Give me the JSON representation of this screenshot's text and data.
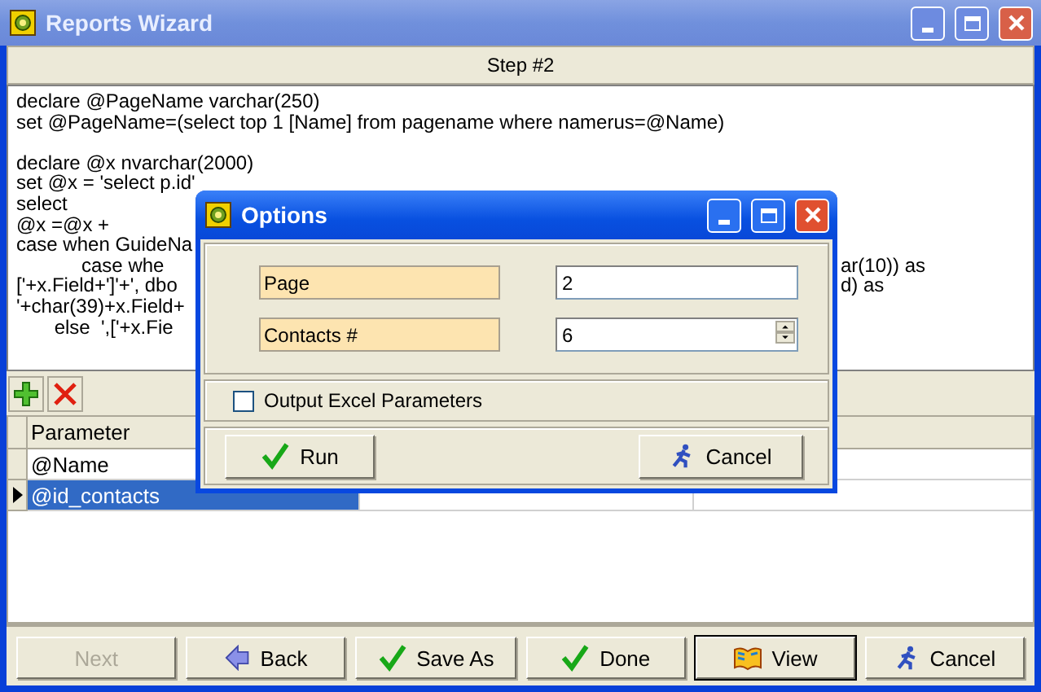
{
  "window": {
    "title": "Reports Wizard"
  },
  "step_header": "Step #2",
  "code_lines": [
    {
      "kind": "text",
      "left": "declare @PageName varchar(250)"
    },
    {
      "kind": "text",
      "left": "set @PageName=(select top 1 [Name] from pagename where namerus=@Name)"
    },
    {
      "kind": "blank"
    },
    {
      "kind": "text",
      "left": "declare @x nvarchar(2000)"
    },
    {
      "kind": "text",
      "left": "set @x = 'select p.id'"
    },
    {
      "kind": "text",
      "left": "select"
    },
    {
      "kind": "text",
      "left": "@x =@x +"
    },
    {
      "kind": "text",
      "left": "case when GuideNa"
    },
    {
      "kind": "text",
      "left": "            case whe",
      "right": "ar(10)) as"
    },
    {
      "kind": "text",
      "left": "['+x.Field+']'+', dbo",
      "right": "d) as"
    },
    {
      "kind": "text",
      "left": "'+char(39)+x.Field+"
    },
    {
      "kind": "text",
      "left": "       else  ',['+x.Fie"
    }
  ],
  "grid": {
    "columns": [
      "Parameter"
    ],
    "rows": [
      {
        "cells": [
          "@Name"
        ],
        "selected": false
      },
      {
        "cells": [
          "@id_contacts"
        ],
        "selected": true
      }
    ]
  },
  "buttons": [
    {
      "label": "Next",
      "kind": "none",
      "disabled": true,
      "default": false
    },
    {
      "label": "Back",
      "kind": "back",
      "disabled": false,
      "default": false
    },
    {
      "label": "Save As",
      "kind": "check",
      "disabled": false,
      "default": false
    },
    {
      "label": "Done",
      "kind": "check",
      "disabled": false,
      "default": false
    },
    {
      "label": "View",
      "kind": "book",
      "disabled": false,
      "default": true
    },
    {
      "label": "Cancel",
      "kind": "runner",
      "disabled": false,
      "default": false
    }
  ],
  "dialog": {
    "title": "Options",
    "fields": [
      {
        "label": "Page",
        "value": "2",
        "kind": "text"
      },
      {
        "label": "Contacts #",
        "value": "6",
        "kind": "spin"
      }
    ],
    "checkbox": {
      "label": "Output Excel Parameters",
      "checked": false
    },
    "buttons": [
      {
        "label": "Run",
        "kind": "check"
      },
      {
        "label": "Cancel",
        "kind": "runner"
      }
    ]
  }
}
